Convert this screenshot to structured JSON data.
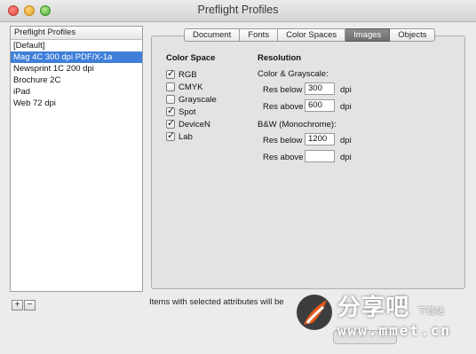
{
  "window": {
    "title": "Preflight Profiles"
  },
  "profiles": {
    "header": "Preflight Profiles",
    "items": [
      {
        "label": "[Default]",
        "selected": false
      },
      {
        "label": "Mag 4C 300 dpi PDF/X-1a",
        "selected": true
      },
      {
        "label": "Newsprint 1C 200 dpi",
        "selected": false
      },
      {
        "label": "Brochure 2C",
        "selected": false
      },
      {
        "label": "iPad",
        "selected": false
      },
      {
        "label": "Web 72 dpi",
        "selected": false
      }
    ],
    "add_label": "+",
    "remove_label": "−"
  },
  "tabs": [
    {
      "label": "Document",
      "active": false
    },
    {
      "label": "Fonts",
      "active": false
    },
    {
      "label": "Color Spaces",
      "active": false
    },
    {
      "label": "Images",
      "active": true
    },
    {
      "label": "Objects",
      "active": false
    }
  ],
  "color_space": {
    "title": "Color Space",
    "options": [
      {
        "label": "RGB",
        "checked": true
      },
      {
        "label": "CMYK",
        "checked": false
      },
      {
        "label": "Grayscale",
        "checked": false
      },
      {
        "label": "Spot",
        "checked": true
      },
      {
        "label": "DeviceN",
        "checked": true
      },
      {
        "label": "Lab",
        "checked": true
      }
    ]
  },
  "resolution": {
    "title": "Resolution",
    "color_gray_label": "Color & Grayscale:",
    "cg_below_label": "Res below",
    "cg_below_value": "300",
    "cg_above_label": "Res above",
    "cg_above_value": "600",
    "bw_label": "B&W (Monochrome):",
    "bw_below_label": "Res below",
    "bw_below_value": "1200",
    "bw_above_label": "Res above",
    "bw_above_value": "",
    "unit": "dpi"
  },
  "footer": {
    "text": "Items with selected attributes will be"
  },
  "watermark": {
    "cn_text": "分享吧",
    "small_text": "下载站",
    "url": "www.mmet.cn"
  }
}
